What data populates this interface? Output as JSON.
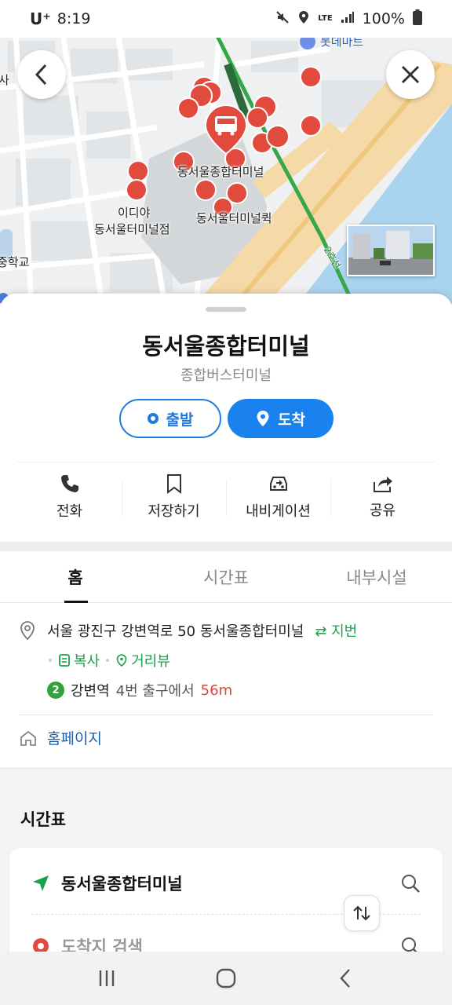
{
  "status_bar": {
    "carrier": "U⁺",
    "time": "8:19",
    "network": "LTE",
    "battery": "100%"
  },
  "map": {
    "poi_label_lotte": "롯데마트",
    "label_terminal": "동서울종합터미널",
    "label_ediya_line1": "이디야",
    "label_ediya_line2": "동서울터미널점",
    "label_quick": "동서울터미널퀵",
    "label_edge_left1": "사",
    "label_edge_left2": "중학교",
    "label_line": "2호선"
  },
  "place": {
    "title": "동서울종합터미널",
    "category": "종합버스터미널"
  },
  "route": {
    "depart_label": "출발",
    "arrive_label": "도착"
  },
  "actions": [
    {
      "label": "전화",
      "icon": "phone-icon"
    },
    {
      "label": "저장하기",
      "icon": "bookmark-icon"
    },
    {
      "label": "내비게이션",
      "icon": "car-navigation-icon"
    },
    {
      "label": "공유",
      "icon": "share-icon"
    }
  ],
  "tabs": [
    {
      "label": "홈"
    },
    {
      "label": "시간표"
    },
    {
      "label": "내부시설"
    }
  ],
  "info": {
    "address": "서울 광진구 강변역로 50 동서울종합터미널",
    "jibun_label": "지번",
    "copy_label": "복사",
    "street_view_label": "거리뷰",
    "subway_line": "2",
    "subway_station": "강변역",
    "subway_exit": "4번 출구에서",
    "subway_distance": "56m",
    "homepage_label": "홈페이지"
  },
  "timetable": {
    "title": "시간표",
    "origin": "동서울종합터미널",
    "destination_placeholder": "도착지 검색"
  }
}
